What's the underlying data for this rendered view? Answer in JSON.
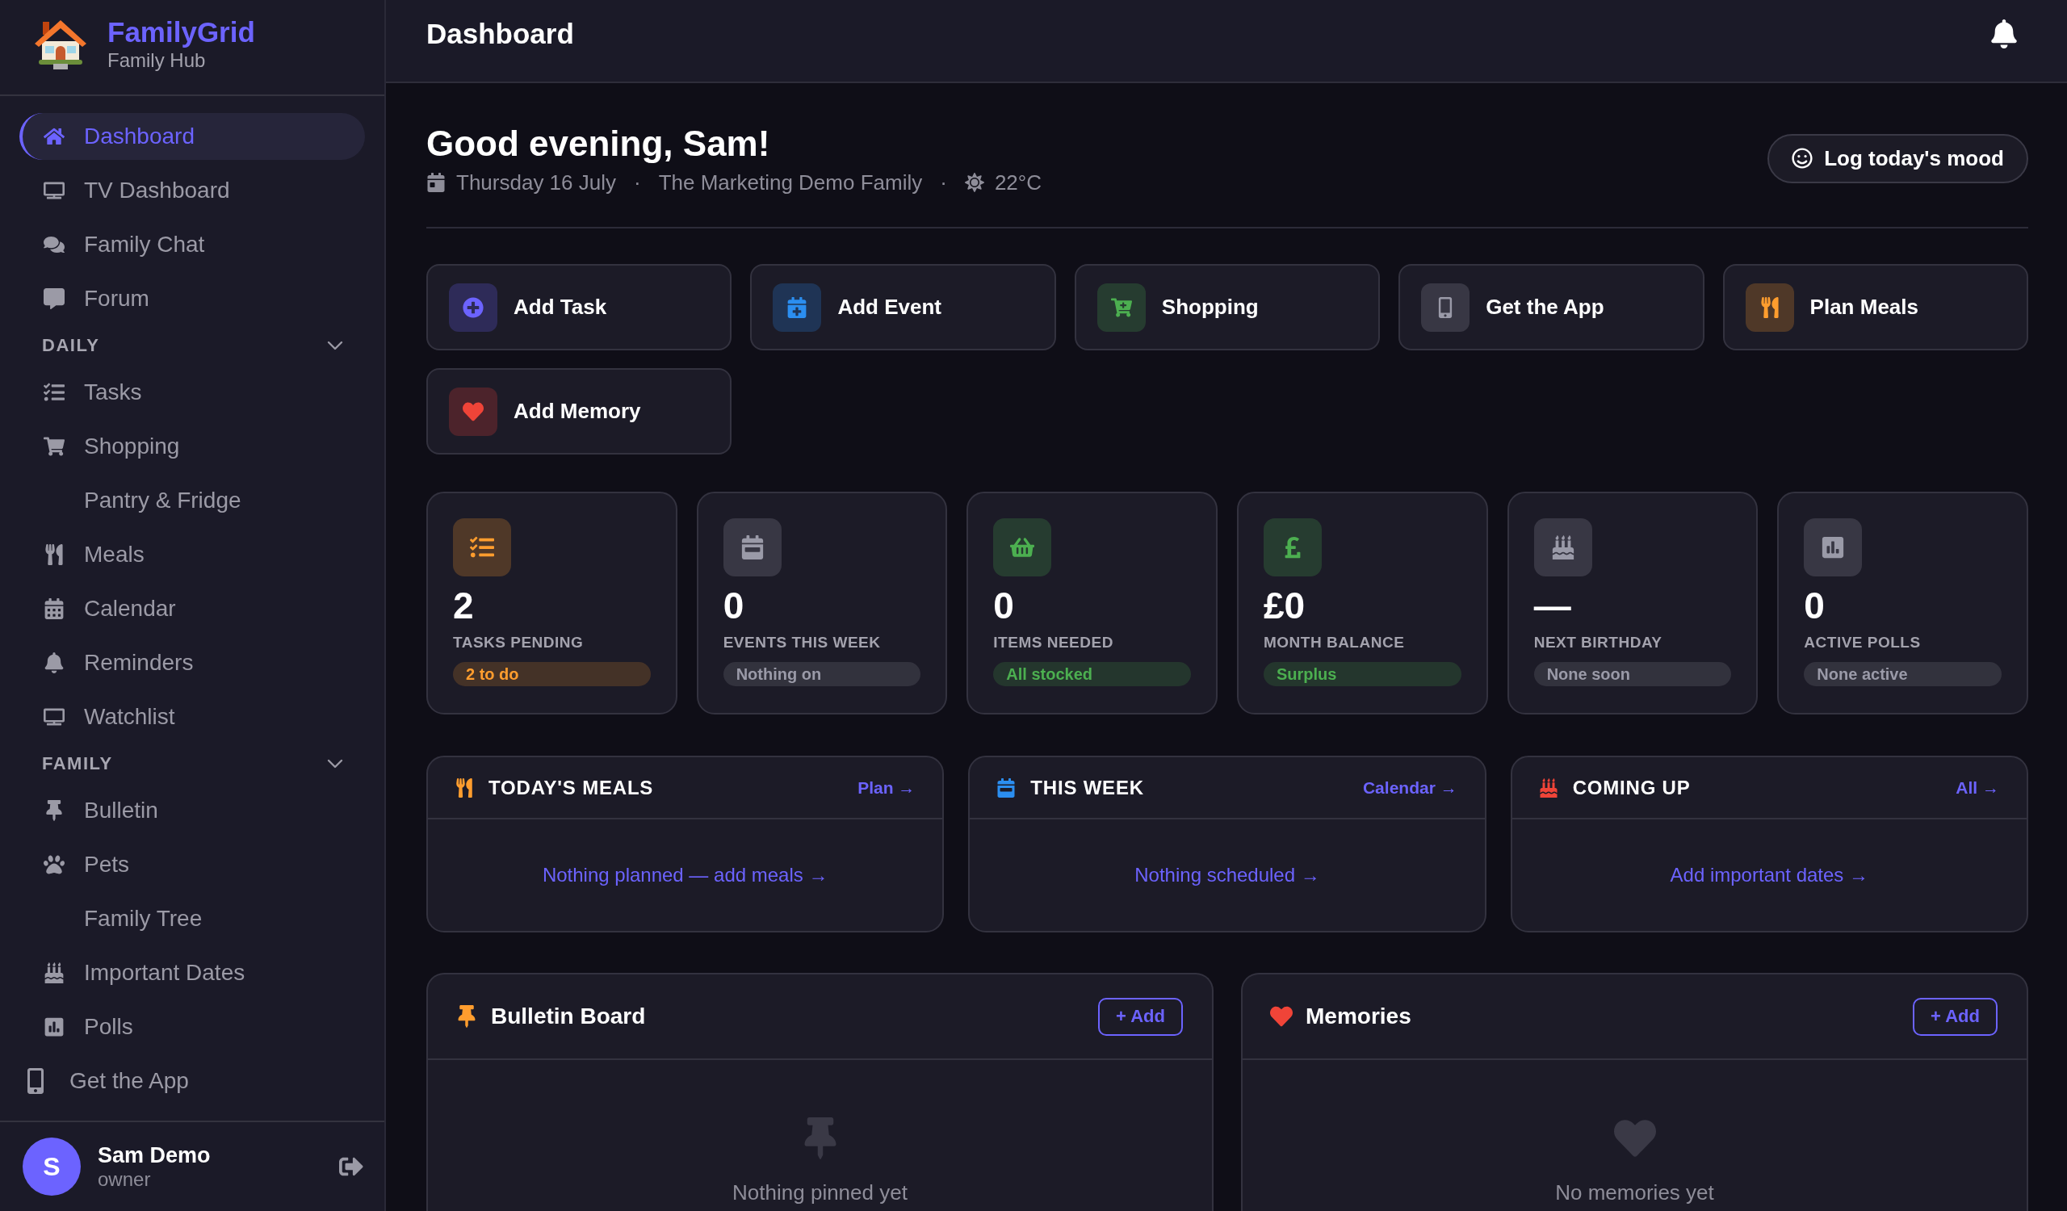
{
  "sidebar": {
    "brand": {
      "name": "FamilyGrid",
      "tagline": "Family Hub"
    },
    "nav": [
      {
        "items": [
          {
            "label": "Dashboard",
            "selected": true
          },
          {
            "label": "TV Dashboard",
            "selected": false
          },
          {
            "label": "Family Chat",
            "selected": false
          },
          {
            "label": "Forum",
            "selected": false
          }
        ]
      },
      {
        "heading": "DAILY",
        "expanded": true,
        "items": [
          {
            "label": "Tasks",
            "selected": false
          },
          {
            "label": "Shopping",
            "selected": false
          },
          {
            "label": "Pantry & Fridge",
            "selected": false
          },
          {
            "label": "Meals",
            "selected": false
          },
          {
            "label": "Calendar",
            "selected": false
          },
          {
            "label": "Reminders",
            "selected": false
          },
          {
            "label": "Watchlist",
            "selected": false
          }
        ]
      },
      {
        "heading": "FAMILY",
        "expanded": true,
        "items": [
          {
            "label": "Bulletin",
            "selected": false
          },
          {
            "label": "Pets",
            "selected": false
          },
          {
            "label": "Family Tree",
            "selected": false
          },
          {
            "label": "Important Dates",
            "selected": false
          },
          {
            "label": "Polls",
            "selected": false
          }
        ]
      }
    ],
    "get_app": "Get the App",
    "user": {
      "initial": "S",
      "name": "Sam Demo",
      "role": "owner"
    }
  },
  "header": {
    "title": "Dashboard"
  },
  "greeting": {
    "title": "Good evening, Sam!",
    "meta": {
      "items": [
        "Thursday 16 July",
        "The Marketing Demo Family",
        "22°C"
      ],
      "separator": "·"
    },
    "mood_button": "Log today's mood"
  },
  "quick_actions": [
    {
      "label": "Add Task",
      "color": "#6c63ff"
    },
    {
      "label": "Add Event",
      "color": "#2b8ef0"
    },
    {
      "label": "Shopping",
      "color": "#4caf50"
    },
    {
      "label": "Get the App",
      "color": "#9a9aa8"
    },
    {
      "label": "Plan Meals",
      "color": "#ff9d2e"
    },
    {
      "label": "Add Memory",
      "color": "#f04438"
    }
  ],
  "stats": [
    {
      "value": "2",
      "label": "TASKS PENDING",
      "badge": "2 to do",
      "color": "#ff9d2e"
    },
    {
      "value": "0",
      "label": "EVENTS THIS WEEK",
      "badge": "Nothing on",
      "color": "#9a9aa8"
    },
    {
      "value": "0",
      "label": "ITEMS NEEDED",
      "badge": "All stocked",
      "color": "#4caf50"
    },
    {
      "value": "£0",
      "label": "MONTH BALANCE",
      "badge": "Surplus",
      "color": "#4caf50"
    },
    {
      "value": "—",
      "label": "NEXT BIRTHDAY",
      "badge": "None soon",
      "color": "#9a9aa8"
    },
    {
      "value": "0",
      "label": "ACTIVE POLLS",
      "badge": "None active",
      "color": "#9a9aa8"
    }
  ],
  "panels": [
    {
      "title": "TODAY'S MEALS",
      "link": "Plan →",
      "empty": "Nothing planned — add meals →",
      "color": "#ff9d2e"
    },
    {
      "title": "THIS WEEK",
      "link": "Calendar →",
      "empty": "Nothing scheduled →",
      "color": "#2b8ef0"
    },
    {
      "title": "COMING UP",
      "link": "All →",
      "empty": "Add important dates →",
      "color": "#f04438"
    }
  ],
  "boards": [
    {
      "title": "Bulletin Board",
      "button": "+ Add",
      "empty": "Nothing pinned yet",
      "color": "#ff9d2e"
    },
    {
      "title": "Memories",
      "button": "+ Add",
      "empty": "No memories yet",
      "color": "#f04438"
    }
  ]
}
